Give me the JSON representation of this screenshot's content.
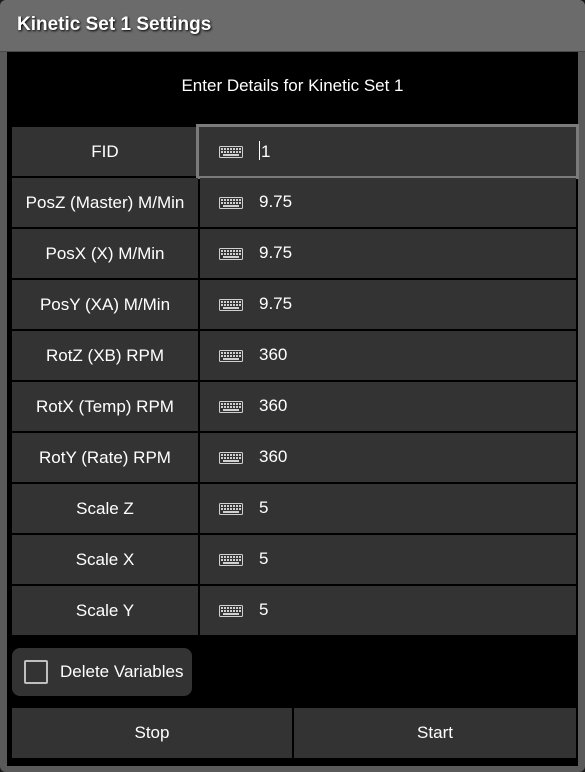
{
  "window": {
    "title": "Kinetic Set 1 Settings"
  },
  "header": {
    "text": "Enter Details for Kinetic Set 1"
  },
  "rows": [
    {
      "label": "FID",
      "value": "1",
      "selected": true
    },
    {
      "label": "PosZ (Master) M/Min",
      "value": "9.75"
    },
    {
      "label": "PosX (X) M/Min",
      "value": "9.75"
    },
    {
      "label": "PosY (XA) M/Min",
      "value": "9.75"
    },
    {
      "label": "RotZ (XB) RPM",
      "value": "360"
    },
    {
      "label": "RotX (Temp) RPM",
      "value": "360"
    },
    {
      "label": "RotY (Rate) RPM",
      "value": "360"
    },
    {
      "label": "Scale Z",
      "value": "5"
    },
    {
      "label": "Scale X",
      "value": "5"
    },
    {
      "label": "Scale Y",
      "value": "5"
    }
  ],
  "options": {
    "delete_variables_label": "Delete Variables",
    "delete_variables_checked": false
  },
  "buttons": {
    "stop_label": "Stop",
    "start_label": "Start"
  },
  "icons": {
    "value_field_icon": "keyboard-icon"
  }
}
